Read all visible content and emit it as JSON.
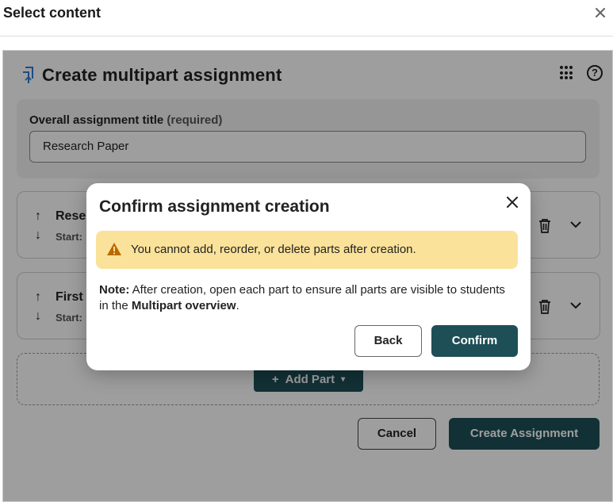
{
  "window": {
    "title": "Select content"
  },
  "app": {
    "title": "Create multipart assignment",
    "title_card": {
      "label": "Overall assignment title",
      "required": "(required)",
      "value": "Research Paper"
    },
    "parts": [
      {
        "title": "Rese",
        "start_label": "Start:"
      },
      {
        "title": "First",
        "start_label": "Start:"
      }
    ],
    "add_part_label": "Add Part",
    "cancel_label": "Cancel",
    "create_label": "Create Assignment"
  },
  "modal": {
    "title": "Confirm assignment creation",
    "warning": "You cannot add, reorder, or delete parts after creation.",
    "note_bold": "Note:",
    "note_text": " After creation, open each part to ensure all parts are visible to students in the ",
    "note_link": "Multipart overview",
    "note_end": ".",
    "back_label": "Back",
    "confirm_label": "Confirm"
  },
  "colors": {
    "primary": "#1e4f57",
    "warning_bg": "#fbe29a",
    "warning_icon": "#b86a00",
    "brand": "#2b7bd6"
  }
}
